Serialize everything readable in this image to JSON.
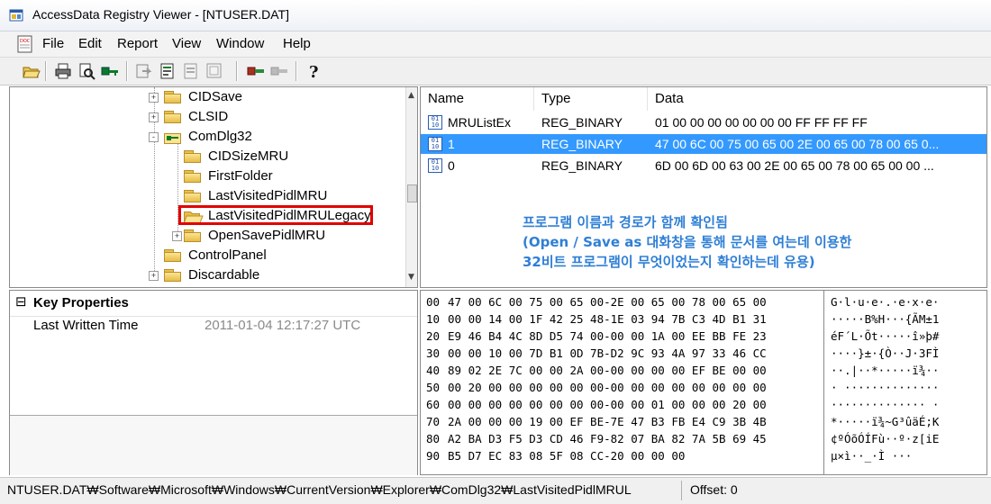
{
  "window": {
    "title": "AccessData Registry Viewer - [NTUSER.DAT]"
  },
  "menu": [
    "File",
    "Edit",
    "Report",
    "View",
    "Window",
    "Help"
  ],
  "toolbar_icons": [
    "open-icon",
    "print-icon",
    "print-preview-icon",
    "key-icon",
    "export-icon",
    "report-icon",
    "report2-icon",
    "summary-icon",
    "registry-icon",
    "registry2-icon",
    "help-icon"
  ],
  "tree": {
    "items": [
      {
        "label": "CIDSave",
        "expander": "+"
      },
      {
        "label": "CLSID",
        "expander": "+"
      },
      {
        "label": "ComDlg32",
        "expander": "-"
      },
      {
        "label": "CIDSizeMRU",
        "expander": ""
      },
      {
        "label": "FirstFolder",
        "expander": ""
      },
      {
        "label": "LastVisitedPidlMRU",
        "expander": ""
      },
      {
        "label": "LastVisitedPidlMRULegacy",
        "expander": ""
      },
      {
        "label": "OpenSavePidlMRU",
        "expander": "+"
      },
      {
        "label": "ControlPanel",
        "expander": ""
      },
      {
        "label": "Discardable",
        "expander": "+"
      }
    ]
  },
  "values": {
    "columns": [
      "Name",
      "Type",
      "Data"
    ],
    "rows": [
      {
        "name": "MRUListEx",
        "type": "REG_BINARY",
        "data": "01 00 00 00 00 00 00 00 FF FF FF FF",
        "selected": false
      },
      {
        "name": "1",
        "type": "REG_BINARY",
        "data": "47 00 6C 00 75 00 65 00 2E 00 65 00 78 00 65 0...",
        "selected": true
      },
      {
        "name": "0",
        "type": "REG_BINARY",
        "data": "6D 00 6D 00 63 00 2E 00 65 00 78 00 65 00 00 ...",
        "selected": false
      }
    ]
  },
  "annotation": {
    "lines": [
      "프로그램 이름과 경로가 함께 확인됨",
      "(Open / Save as 대화창을 통해 문서를 여는데 이용한",
      "32비트 프로그램이 무엇이었는지 확인하는데 유용)"
    ],
    "color": "#2f7fd6"
  },
  "properties": {
    "header": "Key Properties",
    "expander": "⊟",
    "rows": [
      {
        "label": "Last Written Time",
        "value": "2011-01-04 12:17:27 UTC"
      }
    ]
  },
  "hex": {
    "lines": [
      {
        "off": "00",
        "bytes": "47 00 6C 00 75 00 65 00-2E 00 65 00 78 00 65 00",
        "ascii": "G·l·u·e·.·e·x·e·"
      },
      {
        "off": "10",
        "bytes": "00 00 14 00 1F 42 25 48-1E 03 94 7B C3 4D B1 31",
        "ascii": "·····B%H···{ÃM±1"
      },
      {
        "off": "20",
        "bytes": "E9 46 B4 4C 8D D5 74 00-00 00 1A 00 EE BB FE 23",
        "ascii": "éF´L·Õt·····î»þ#"
      },
      {
        "off": "30",
        "bytes": "00 00 10 00 7D B1 0D 7B-D2 9C 93 4A 97 33 46 CC",
        "ascii": "····}±·{Ò··J·3FÌ"
      },
      {
        "off": "40",
        "bytes": "89 02 2E 7C 00 00 2A 00-00 00 00 00 EF BE 00 00",
        "ascii": "··.|··*·····ï¾··"
      },
      {
        "off": "50",
        "bytes": "00 20 00 00 00 00 00 00-00 00 00 00 00 00 00 00",
        "ascii": "· ··············"
      },
      {
        "off": "60",
        "bytes": "00 00 00 00 00 00 00 00-00 00 01 00 00 00 20 00",
        "ascii": "·············· ·"
      },
      {
        "off": "70",
        "bytes": "2A 00 00 00 19 00 EF BE-7E 47 B3 FB E4 C9 3B 4B",
        "ascii": "*·····ï¾~G³ûäÉ;K"
      },
      {
        "off": "80",
        "bytes": "A2 BA D3 F5 D3 CD 46 F9-82 07 BA 82 7A 5B 69 45",
        "ascii": "¢ºÓõÓÍFù··º·z[iE"
      },
      {
        "off": "90",
        "bytes": "B5 D7 EC 83 08 5F 08 CC-20 00 00 00",
        "ascii": "µ×ì··_·Ì ···"
      }
    ]
  },
  "status": {
    "path": "NTUSER.DAT₩Software₩Microsoft₩Windows₩CurrentVersion₩Explorer₩ComDlg32₩LastVisitedPidlMRUL",
    "offset": "Offset: 0"
  },
  "colors": {
    "selection": "#3399ff",
    "highlight_box": "#e00000"
  }
}
